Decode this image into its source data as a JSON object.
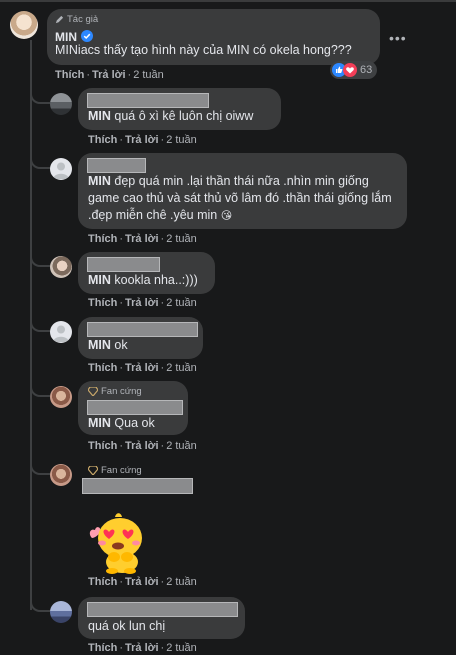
{
  "actions": {
    "like": "Thích",
    "reply": "Trả lời"
  },
  "main_comment": {
    "badge": "Tác giả",
    "author": "MIN",
    "text": "MINiacs thấy tạo hình này của MIN có okela hong???",
    "time": "2 tuần",
    "reaction_count": "63",
    "reactions": [
      "like-icon",
      "love-icon"
    ]
  },
  "replies": [
    {
      "mention": "MIN",
      "text": " quá ô xì kê luôn chị oiww",
      "time": "2 tuần"
    },
    {
      "mention": "MIN",
      "text": " đẹp quá min .lại thần thái nữa .nhìn min giống game cao thủ và sát thủ võ lâm đó .thần thái giống lắm .đẹp miễn chê .yêu min",
      "emoji": "😘",
      "time": "2 tuần"
    },
    {
      "mention": "MIN",
      "text": " kookla nha..:)))",
      "time": "2 tuần"
    },
    {
      "mention": "MIN",
      "text": " ok",
      "time": "2 tuần"
    },
    {
      "badge": "Fan cứng",
      "mention": "MIN",
      "text": " Qua ok",
      "time": "2 tuần"
    },
    {
      "badge": "Fan cứng",
      "sticker": "heart-eyes-sticker",
      "time": "2 tuần"
    },
    {
      "text": "quá ok lun chị",
      "time": "2 tuần"
    }
  ],
  "colors": {
    "background": "#18191a",
    "bubble": "#3a3b3c",
    "verified": "#2d88ff",
    "muted": "#b0b3b8"
  }
}
